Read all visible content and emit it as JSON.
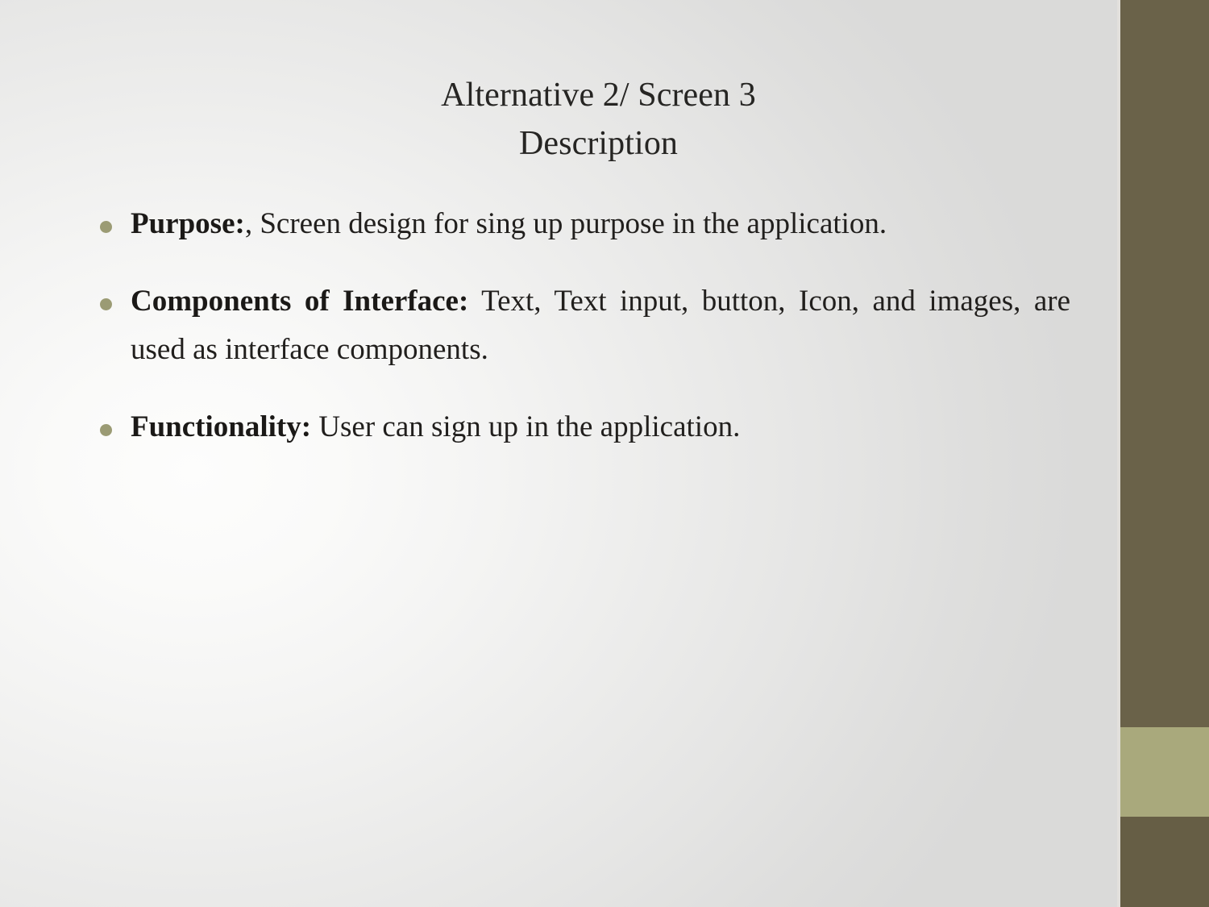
{
  "slide": {
    "title_lines": [
      "Alternative 2/ Screen 3",
      "Description"
    ],
    "bullets": [
      {
        "lead": "Purpose:",
        "rest": ", Screen design for sing up purpose in the application."
      },
      {
        "lead": "Components of Interface:",
        "rest": " Text, Text input, button, Icon, and images, are used as interface components."
      },
      {
        "lead": "Functionality:",
        "rest": " User can sign up in the application."
      }
    ]
  },
  "decor": {
    "bullet_color": "#9b9b74",
    "side_bar_dark_color": "#6a6249",
    "side_bar_light_color": "#a9a97c",
    "side_bar_bottom_color": "#665e45",
    "text_color": "#211f1d",
    "title_color": "#262523"
  }
}
